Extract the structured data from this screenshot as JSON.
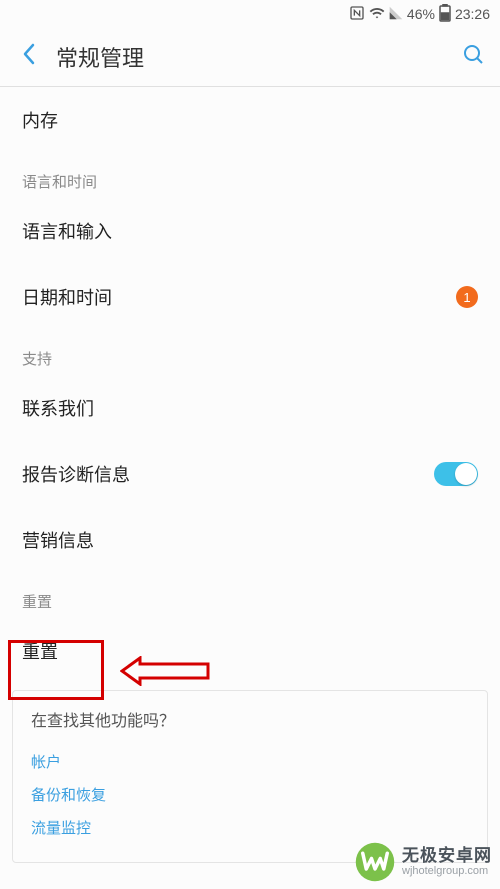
{
  "status_bar": {
    "battery_pct": "46%",
    "time": "23:26"
  },
  "header": {
    "title": "常规管理"
  },
  "sections": {
    "storage_label": "内存",
    "lang_time_header": "语言和时间",
    "lang_input_label": "语言和输入",
    "date_time_label": "日期和时间",
    "date_time_badge": "1",
    "support_header": "支持",
    "contact_label": "联系我们",
    "diag_label": "报告诊断信息",
    "marketing_label": "营销信息",
    "reset_header": "重置",
    "reset_label": "重置"
  },
  "card": {
    "title": "在查找其他功能吗？",
    "link1": "帐户",
    "link2": "备份和恢复",
    "link3": "流量监控"
  },
  "watermark": {
    "title": "无极安卓网",
    "sub": "wjhotelgroup.com"
  }
}
